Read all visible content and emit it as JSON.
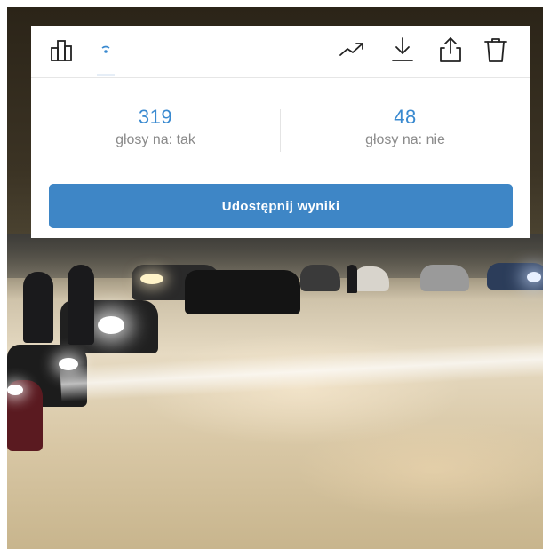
{
  "toolbar": {
    "icons": [
      "bar-chart-icon",
      "broadcast-icon",
      "trending-icon",
      "download-icon",
      "share-icon",
      "trash-icon"
    ],
    "active_tab": "broadcast-icon"
  },
  "results": {
    "yes": {
      "count": "319",
      "label": "głosy na: tak"
    },
    "no": {
      "count": "48",
      "label": "głosy na: nie"
    }
  },
  "share_button_label": "Udostępnij wyniki",
  "colors": {
    "accent": "#3a8ad0",
    "button": "#3e86c6",
    "label": "#8a8a8a",
    "icon": "#222222"
  }
}
